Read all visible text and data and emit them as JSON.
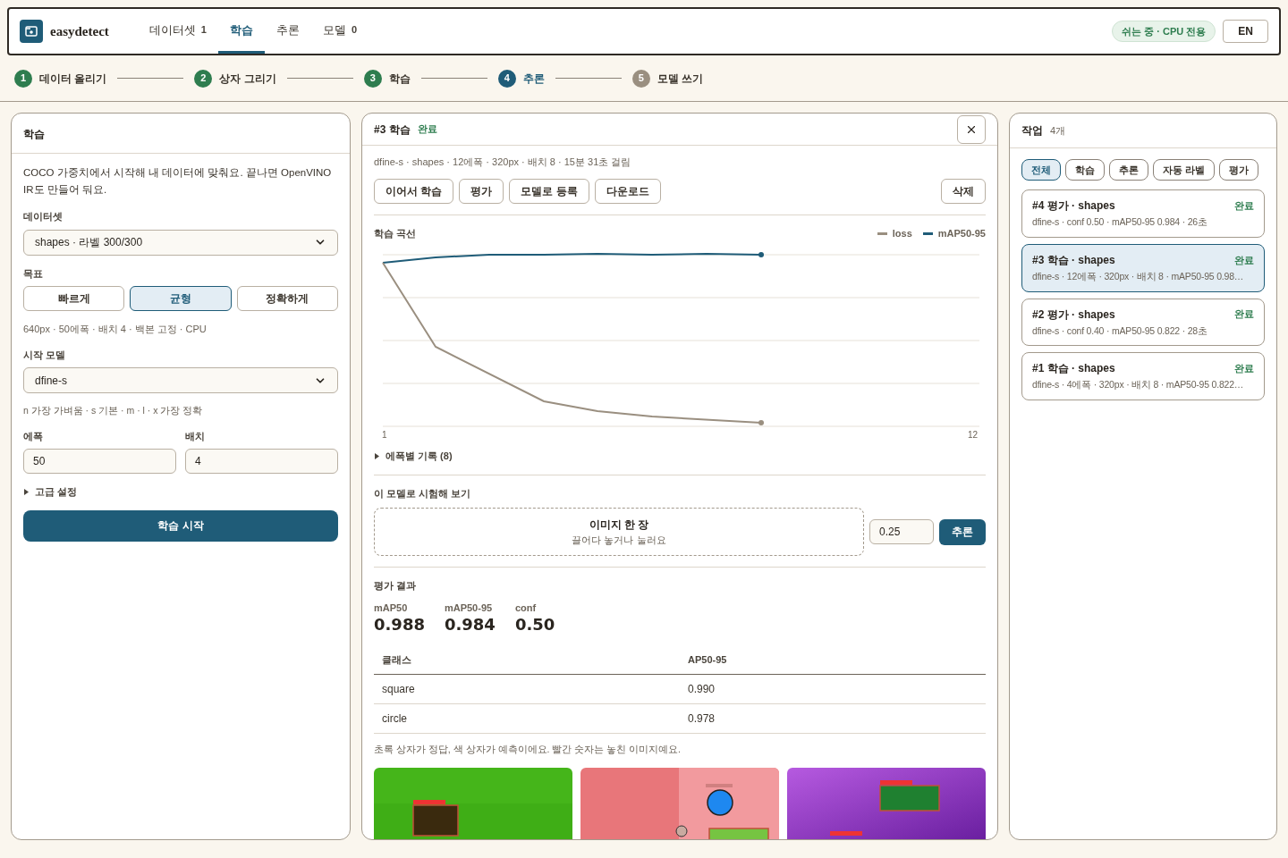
{
  "header": {
    "logo": "easydetect",
    "nav": [
      {
        "label": "데이터셋",
        "count": "1",
        "selected": false
      },
      {
        "label": "학습",
        "selected": true
      },
      {
        "label": "추론",
        "selected": false
      },
      {
        "label": "모델",
        "count": "0",
        "selected": false
      }
    ],
    "status_badge": "쉬는 중 · CPU 전용",
    "language_button": "EN"
  },
  "steps": [
    {
      "number": "1",
      "label": "데이터 올리기",
      "completed": true,
      "current": false
    },
    {
      "number": "2",
      "label": "상자 그리기",
      "completed": true,
      "current": false
    },
    {
      "number": "3",
      "label": "학습",
      "completed": true,
      "current": false
    },
    {
      "number": "4",
      "label": "추론",
      "completed": false,
      "current": true
    },
    {
      "number": "5",
      "label": "모델 쓰기",
      "completed": false,
      "current": false
    }
  ],
  "train_panel": {
    "title": "학습",
    "description": "COCO 가중치에서 시작해 내 데이터에 맞춰요. 끝나면 OpenVINO IR도 만들어 둬요.",
    "dataset_label": "데이터셋",
    "dataset_value": "shapes · 라벨 300/300",
    "goal_label": "목표",
    "goals": [
      {
        "label": "빠르게",
        "selected": false
      },
      {
        "label": "균형",
        "selected": true
      },
      {
        "label": "정확하게",
        "selected": false
      }
    ],
    "goal_hint": "640px · 50에폭 · 배치 4 · 백본 고정 · CPU",
    "model_label": "시작 모델",
    "model_value": "dfine-s",
    "model_hint": "n 가장 가벼움 · s 기본 · m · l · x 가장 정확",
    "epochs_label": "에폭",
    "epochs_value": "50",
    "batch_label": "배치",
    "batch_value": "4",
    "advanced": {
      "label": "고급 설정",
      "expanded": false
    },
    "start_button": "학습 시작"
  },
  "job_detail": {
    "title": "#3 학습",
    "status": "완료",
    "summary": "dfine-s · shapes · 12에폭 · 320px · 배치 8 · 15분 31초 걸림",
    "actions": [
      "이어서 학습",
      "평가",
      "모델로 등록",
      "다운로드"
    ],
    "delete_button": "삭제",
    "curve": {
      "title": "학습 곡선",
      "legend": [
        {
          "name": "loss",
          "color": "#9a8f80"
        },
        {
          "name": "mAP50-95",
          "color": "#1f5c78"
        }
      ],
      "x_start": "1",
      "x_end": "12"
    },
    "epoch_log": {
      "label": "에폭별 기록 (8)",
      "expanded": false
    },
    "try": {
      "title": "이 모델로 시험해 보기",
      "drop_title": "이미지 한 장",
      "drop_hint": "끌어다 놓거나 눌러요",
      "conf_value": "0.25",
      "run_button": "추론"
    },
    "eval": {
      "title": "평가 결과",
      "metrics": [
        {
          "label": "mAP50",
          "value": "0.988"
        },
        {
          "label": "mAP50-95",
          "value": "0.984"
        },
        {
          "label": "conf",
          "value": "0.50"
        }
      ],
      "table": {
        "columns": [
          "클래스",
          "AP50-95"
        ],
        "rows": [
          [
            "square",
            "0.990"
          ],
          [
            "circle",
            "0.978"
          ]
        ]
      },
      "note": "초록 상자가 정답, 색 상자가 예측이에요. 빨간 숫자는 놓친 이미지예요."
    }
  },
  "jobs": {
    "title": "작업",
    "count": "4개",
    "filters": [
      {
        "label": "전체",
        "selected": true
      },
      {
        "label": "학습",
        "selected": false
      },
      {
        "label": "추론",
        "selected": false
      },
      {
        "label": "자동 라벨",
        "selected": false
      },
      {
        "label": "평가",
        "selected": false
      }
    ],
    "items": [
      {
        "title": "#4 평가 · shapes",
        "status": "완료",
        "meta": "dfine-s · conf 0.50 · mAP50-95 0.984 · 26초",
        "selected": false
      },
      {
        "title": "#3 학습 · shapes",
        "status": "완료",
        "meta": "dfine-s · 12에폭 · 320px · 배치 8 · mAP50-95 0.98…",
        "selected": true
      },
      {
        "title": "#2 평가 · shapes",
        "status": "완료",
        "meta": "dfine-s · conf 0.40 · mAP50-95 0.822 · 28초",
        "selected": false
      },
      {
        "title": "#1 학습 · shapes",
        "status": "완료",
        "meta": "dfine-s · 4에폭 · 320px · 배치 8 · mAP50-95 0.822…",
        "selected": false
      }
    ]
  }
}
